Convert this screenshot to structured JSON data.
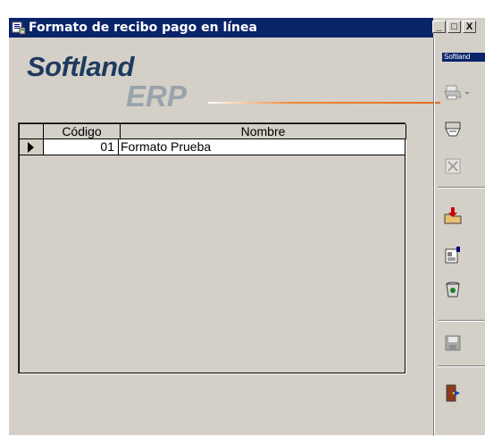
{
  "window": {
    "title": "Formato de recibo pago en línea",
    "minimize": "_",
    "maximize": "□",
    "close": "X"
  },
  "brand": {
    "name": "Softland",
    "product": "ERP",
    "tag": "Softland"
  },
  "grid": {
    "columns": [
      "Código",
      "Nombre"
    ],
    "rows": [
      {
        "codigo": "01",
        "nombre": "Formato Prueba"
      }
    ]
  },
  "toolbar": {
    "items": [
      "print-icon",
      "dropdown-icon",
      "preview-icon",
      "excel-icon",
      "import-icon",
      "properties-icon",
      "delete-icon",
      "save-icon",
      "exit-icon"
    ]
  },
  "colors": {
    "titlebar": "#0a246a",
    "face": "#d4d0c8",
    "brand": "#1d3a5f",
    "accent": "#f08a3a"
  }
}
